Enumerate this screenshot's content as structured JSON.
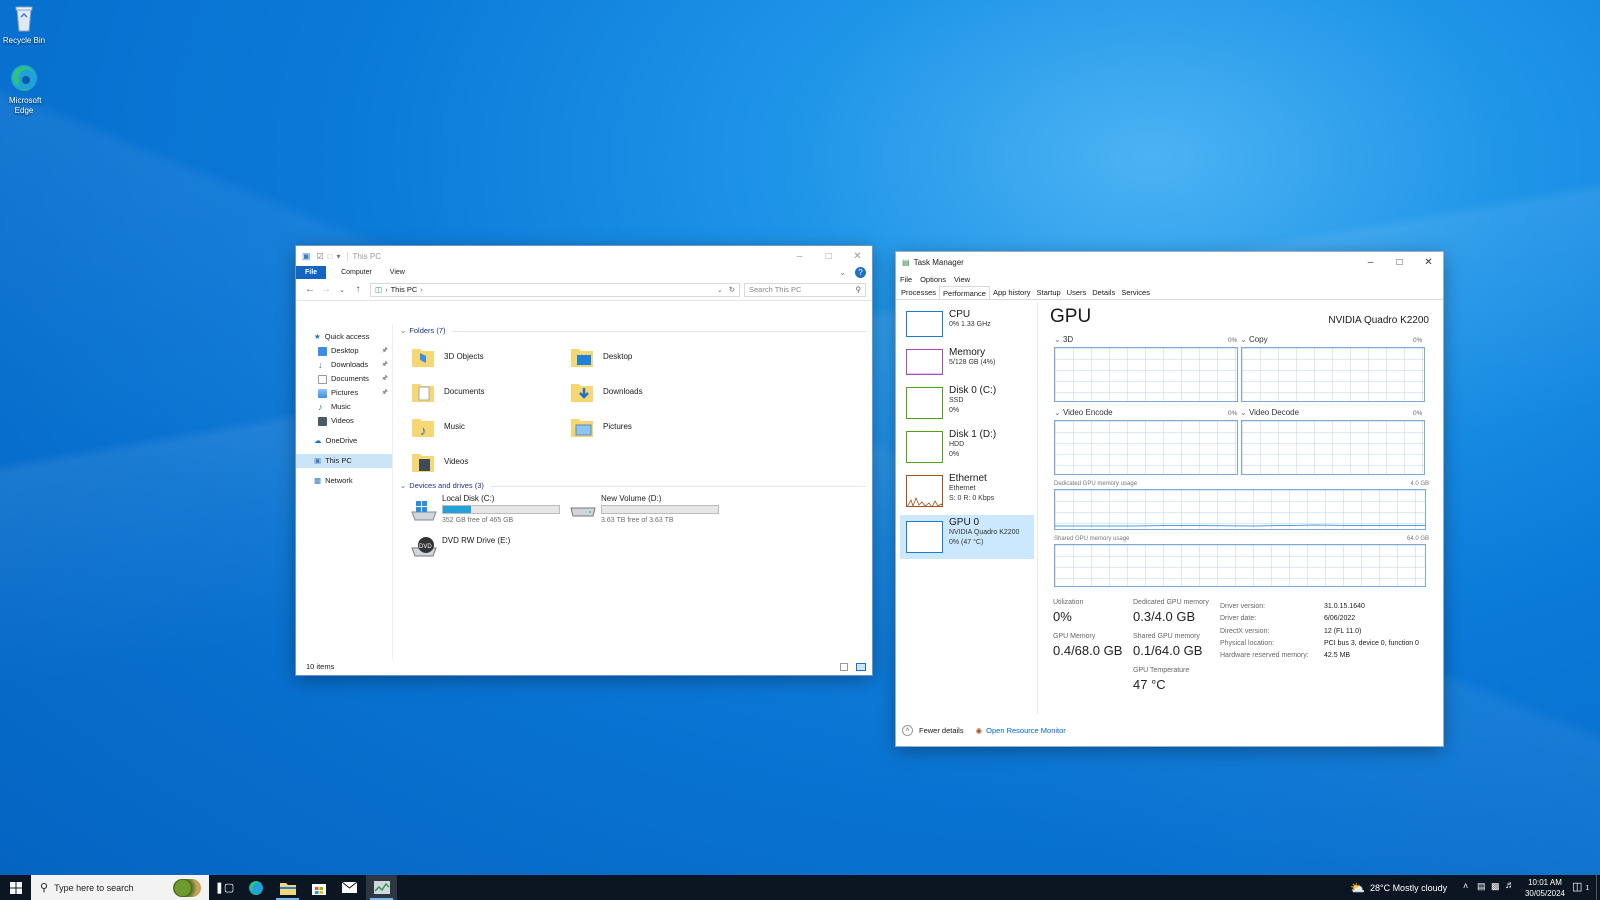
{
  "desktop": {
    "icons": [
      {
        "label": "Recycle Bin",
        "icon": "recycle-bin-icon"
      },
      {
        "label": "Microsoft Edge",
        "icon": "edge-icon"
      }
    ]
  },
  "explorer": {
    "title": "This PC",
    "ribbon_tabs": [
      "File",
      "Computer",
      "View"
    ],
    "breadcrumb": "This PC",
    "search_placeholder": "Search This PC",
    "nav": {
      "quick_access": "Quick access",
      "quick_items": [
        "Desktop",
        "Downloads",
        "Documents",
        "Pictures",
        "Music",
        "Videos"
      ],
      "onedrive": "OneDrive",
      "this_pc": "This PC",
      "network": "Network"
    },
    "folders_header": "Folders (7)",
    "folders": [
      "3D Objects",
      "Desktop",
      "Documents",
      "Downloads",
      "Music",
      "Pictures",
      "Videos"
    ],
    "drives_header": "Devices and drives (3)",
    "drives": [
      {
        "name": "Local Disk (C:)",
        "free": "352 GB free of 465 GB",
        "used_fraction": 0.243
      },
      {
        "name": "New Volume (D:)",
        "free": "3.63 TB free of 3.63 TB",
        "used_fraction": 0.0
      },
      {
        "name": "DVD RW Drive (E:)",
        "icon_text": "DVD"
      }
    ],
    "status": "10 items"
  },
  "taskmgr": {
    "title": "Task Manager",
    "menu": [
      "File",
      "Options",
      "View"
    ],
    "tabs": [
      "Processes",
      "Performance",
      "App history",
      "Startup",
      "Users",
      "Details",
      "Services"
    ],
    "perf_items": [
      {
        "name": "CPU",
        "d1": "0%  1.33 GHz",
        "d2": ""
      },
      {
        "name": "Memory",
        "d1": "5/128 GB (4%)",
        "d2": ""
      },
      {
        "name": "Disk 0 (C:)",
        "d1": "SSD",
        "d2": "0%"
      },
      {
        "name": "Disk 1 (D:)",
        "d1": "HDD",
        "d2": "0%"
      },
      {
        "name": "Ethernet",
        "d1": "Ethernet",
        "d2": "S: 0  R: 0 Kbps"
      },
      {
        "name": "GPU 0",
        "d1": "NVIDIA Quadro K2200",
        "d2": "0%  (47 °C)"
      }
    ],
    "gpu": {
      "heading": "GPU",
      "model": "NVIDIA Quadro K2200",
      "engines": [
        {
          "label": "3D",
          "pct": "0%"
        },
        {
          "label": "Copy",
          "pct": "0%"
        },
        {
          "label": "Video Encode",
          "pct": "0%"
        },
        {
          "label": "Video Decode",
          "pct": "0%"
        }
      ],
      "dedicated_label": "Dedicated GPU memory usage",
      "dedicated_max": "4.0 GB",
      "shared_label": "Shared GPU memory usage",
      "shared_max": "64.0 GB",
      "stats": {
        "utilization_label": "Utilization",
        "utilization": "0%",
        "gpu_memory_label": "GPU Memory",
        "gpu_memory": "0.4/68.0 GB",
        "dedicated_label": "Dedicated GPU memory",
        "dedicated": "0.3/4.0 GB",
        "shared_label": "Shared GPU memory",
        "shared": "0.1/64.0 GB",
        "temp_label": "GPU Temperature",
        "temp": "47 °C"
      },
      "details": [
        {
          "k": "Driver version:",
          "v": "31.0.15.1640"
        },
        {
          "k": "Driver date:",
          "v": "6/06/2022"
        },
        {
          "k": "DirectX version:",
          "v": "12 (FL 11.0)"
        },
        {
          "k": "Physical location:",
          "v": "PCI bus 3, device 0, function 0"
        },
        {
          "k": "Hardware reserved memory:",
          "v": "42.5 MB"
        }
      ]
    },
    "footer": {
      "fewer": "Fewer details",
      "resmon": "Open Resource Monitor"
    }
  },
  "taskbar": {
    "search_placeholder": "Type here to search",
    "weather": "28°C  Mostly cloudy",
    "time": "10:01 AM",
    "date": "30/05/2024",
    "notif_count": "1"
  },
  "colors": {
    "cpu": "#1b7cd4",
    "memory": "#a64dbd",
    "disk": "#4da60c",
    "ethernet": "#a7521c",
    "gpu": "#1b7cd4",
    "accent": "#26a0da"
  }
}
